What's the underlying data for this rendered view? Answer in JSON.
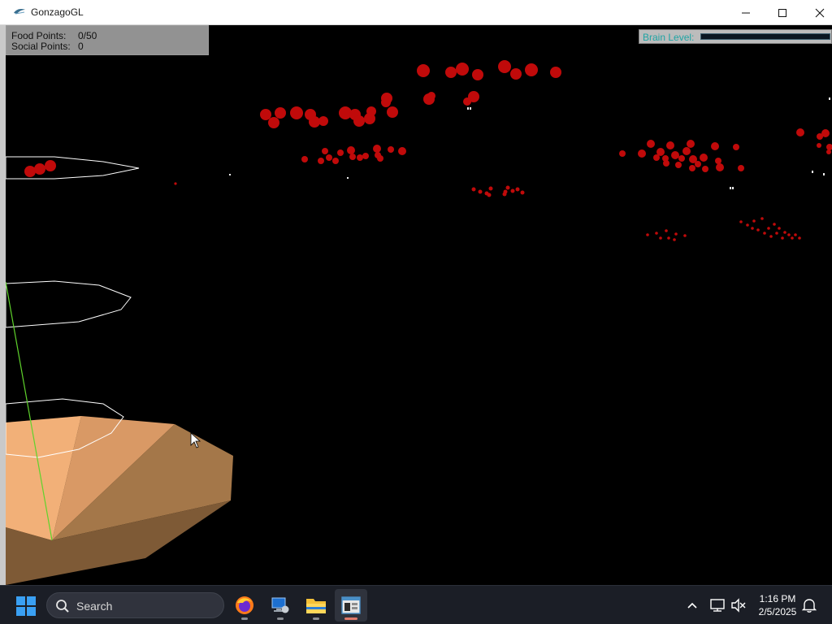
{
  "window": {
    "title": "GonzagoGL",
    "controls": {
      "minimize": "minimize",
      "maximize": "maximize",
      "close": "close"
    }
  },
  "hud": {
    "food_label": "Food Points:",
    "food_value": "0/50",
    "social_label": "Social Points:",
    "social_value": "0",
    "brain_label": "Brain Level:",
    "brain_level_fraction": 0.0
  },
  "scene": {
    "background": "#000000",
    "food_color": "#c00a0a",
    "ring_color": "#ffffff",
    "ground_colors": [
      "#f6b47b",
      "#dc9a64",
      "#a57849",
      "#7f5a36"
    ],
    "axis_line_color": "#5fd32c"
  },
  "taskbar": {
    "search_placeholder": "Search",
    "apps": [
      {
        "name": "firefox",
        "icon": "firefox-icon"
      },
      {
        "name": "remote-desktop",
        "icon": "remote-desktop-icon"
      },
      {
        "name": "file-explorer",
        "icon": "folder-icon"
      },
      {
        "name": "gonzagogl",
        "icon": "app-window-icon",
        "active": true
      }
    ],
    "tray_icons": [
      "chevron-up-icon",
      "network-icon",
      "volume-muted-icon"
    ],
    "time": "1:16 PM",
    "date": "2/5/2025",
    "notification_icon": "bell-icon"
  }
}
